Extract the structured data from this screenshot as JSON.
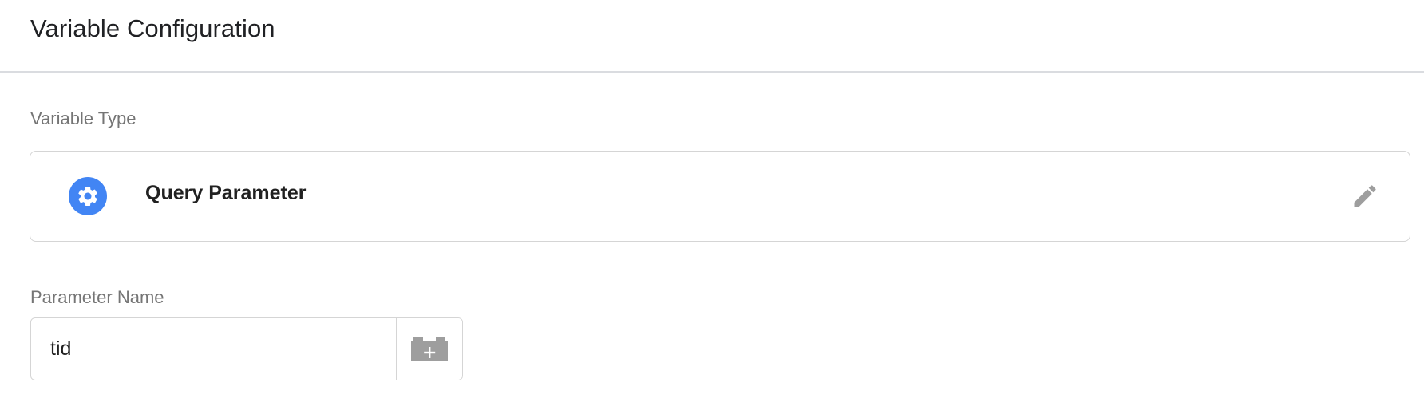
{
  "header": {
    "title": "Variable Configuration"
  },
  "variable_type": {
    "label": "Variable Type",
    "selected_name": "Query Parameter",
    "icon": "gear-icon",
    "icon_color": "#4285f4",
    "edit_icon": "pencil-icon"
  },
  "parameter_name": {
    "label": "Parameter Name",
    "value": "tid",
    "variable_picker_icon": "add-variable-brick-icon"
  }
}
